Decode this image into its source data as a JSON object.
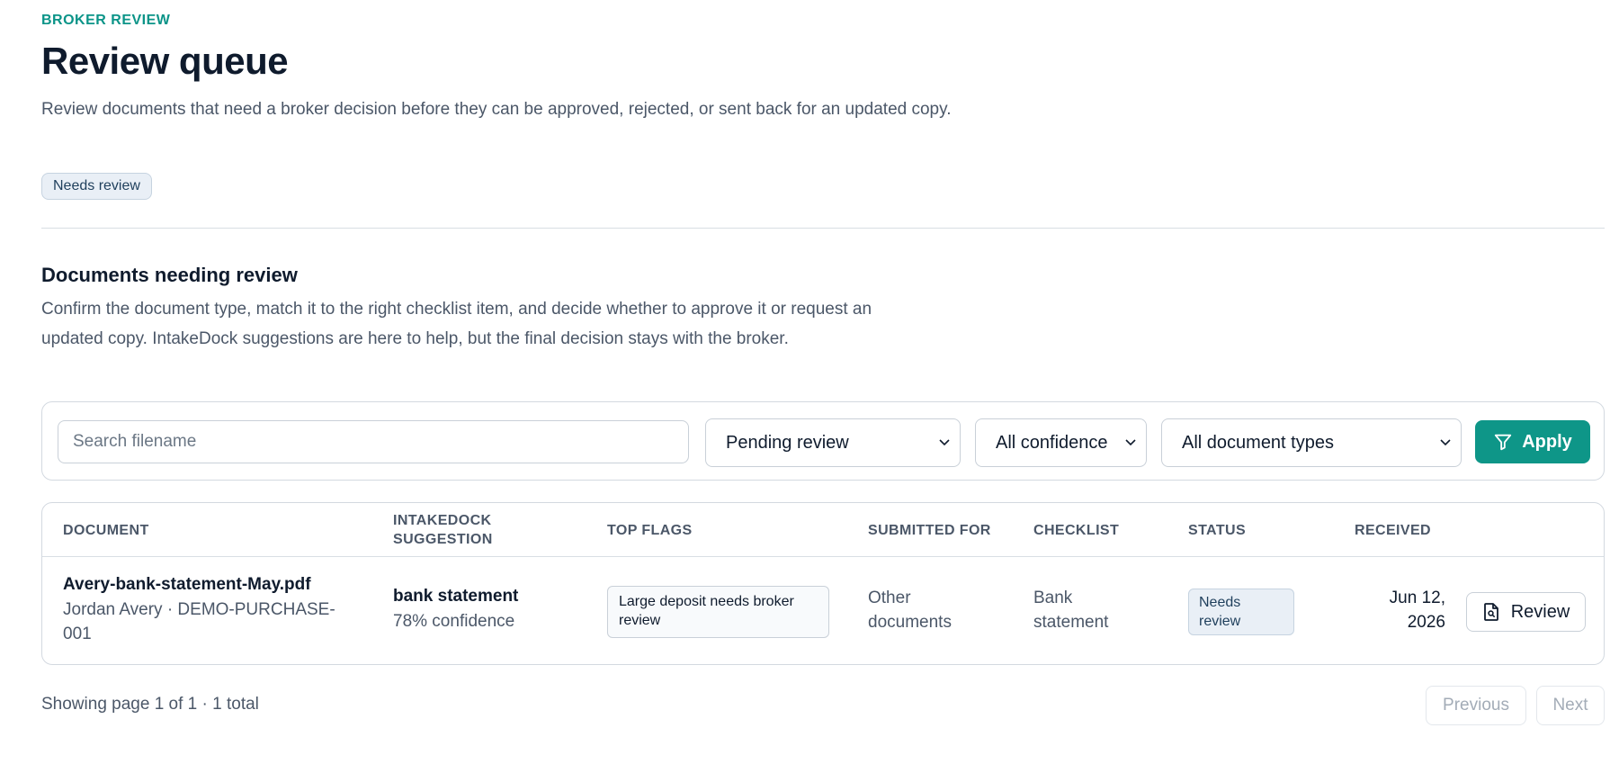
{
  "header": {
    "eyebrow": "BROKER REVIEW",
    "title": "Review queue",
    "description": "Review documents that need a broker decision before they can be approved, rejected, or sent back for an updated copy.",
    "badge": "Needs review"
  },
  "section": {
    "title": "Documents needing review",
    "description": "Confirm the document type, match it to the right checklist item, and decide whether to approve it or request an updated copy. IntakeDock suggestions are here to help, but the final decision stays with the broker."
  },
  "filters": {
    "search_placeholder": "Search filename",
    "status_value": "Pending review",
    "confidence_value": "All confidence",
    "type_value": "All document types",
    "apply_label": "Apply"
  },
  "table": {
    "columns": {
      "document": "DOCUMENT",
      "suggestion": "INTAKEDOCK SUGGESTION",
      "flags": "TOP FLAGS",
      "submitted_for": "SUBMITTED FOR",
      "checklist": "CHECKLIST",
      "status": "STATUS",
      "received": "RECEIVED"
    },
    "rows": [
      {
        "filename": "Avery-bank-statement-May.pdf",
        "client": "Jordan Avery · DEMO-PURCHASE-001",
        "suggestion": "bank statement",
        "confidence": "78% confidence",
        "flag": "Large deposit needs broker review",
        "submitted_for": "Other documents",
        "checklist": "Bank statement",
        "status": "Needs review",
        "received": "Jun 12, 2026",
        "action": "Review"
      }
    ]
  },
  "pagination": {
    "summary": "Showing page 1 of 1 · 1 total",
    "previous": "Previous",
    "next": "Next"
  },
  "colors": {
    "accent": "#0e9688",
    "text": "#0f1b2d",
    "muted": "#4b5768",
    "badge_bg": "#e9eff6"
  }
}
